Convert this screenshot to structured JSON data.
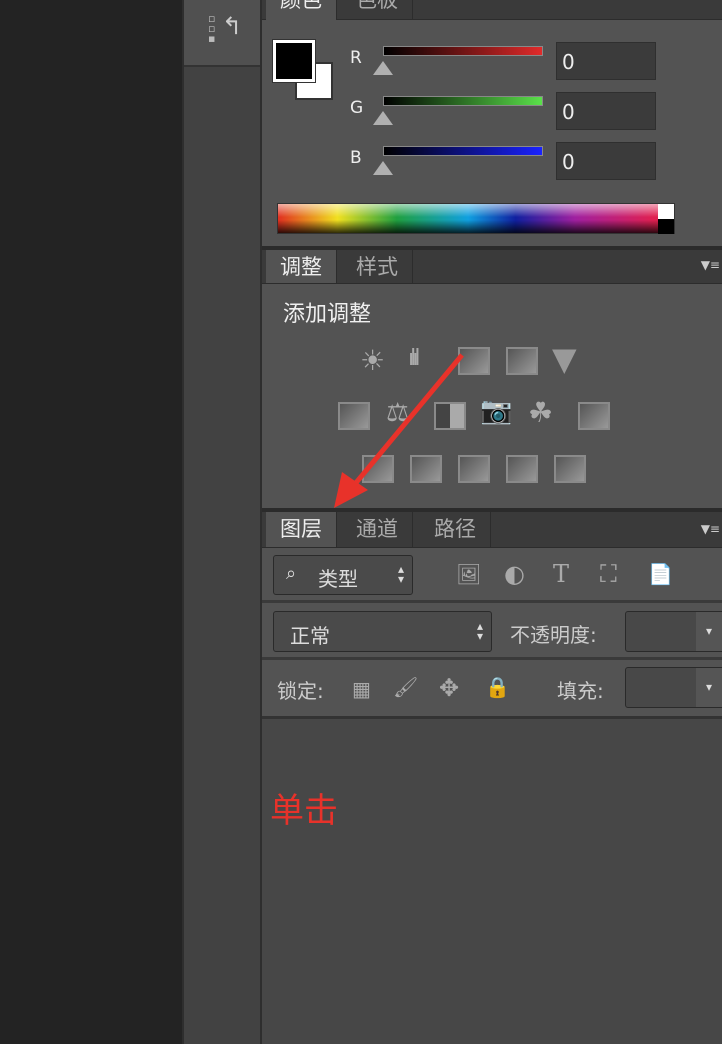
{
  "color_panel": {
    "tabs": [
      "颜色",
      "色板"
    ],
    "channels": [
      {
        "label": "R",
        "value": "0",
        "color": "#e02a2a"
      },
      {
        "label": "G",
        "value": "0",
        "color": "#5ae04a"
      },
      {
        "label": "B",
        "value": "0",
        "color": "#1a22ff"
      }
    ],
    "foreground": "#000000",
    "background": "#ffffff"
  },
  "adjust_panel": {
    "tabs": [
      "调整",
      "样式"
    ],
    "title": "添加调整"
  },
  "layers_panel": {
    "tabs": [
      "图层",
      "通道",
      "路径"
    ],
    "filter_label": "类型",
    "blend_mode": "正常",
    "opacity_label": "不透明度:",
    "lock_label": "锁定:",
    "fill_label": "填充:"
  },
  "annotation": {
    "text": "单击",
    "color": "#e8322a"
  }
}
